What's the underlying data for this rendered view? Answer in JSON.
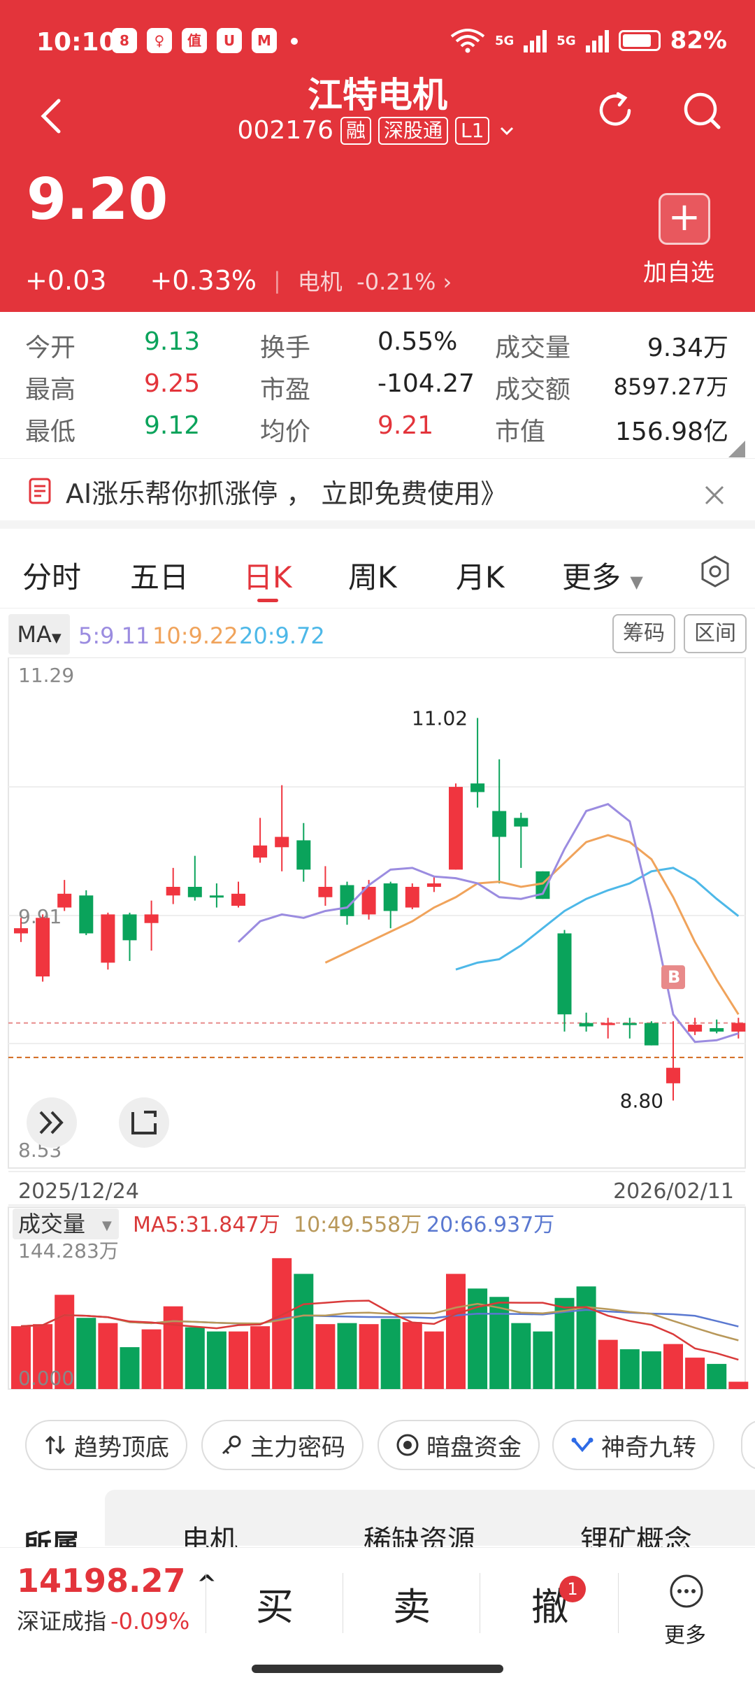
{
  "status": {
    "time": "10:10",
    "battery": "82%",
    "net1": "5G",
    "net2": "5G",
    "apps": [
      "8",
      "♀",
      "值",
      "U",
      "M"
    ]
  },
  "header": {
    "name": "江特电机",
    "code": "002176",
    "tags": [
      "融",
      "深股通",
      "L1"
    ],
    "price": "9.20",
    "change": "+0.03",
    "change_pct": "+0.33%",
    "sector_name": "电机",
    "sector_chg": "-0.21%",
    "add_label": "加自选",
    "add_icon": "+"
  },
  "quote": {
    "open_label": "今开",
    "open": "9.13",
    "high_label": "最高",
    "high": "9.25",
    "low_label": "最低",
    "low": "9.12",
    "turnover_label": "换手",
    "turnover": "0.55%",
    "pe_label": "市盈",
    "pe": "-104.27",
    "avg_label": "均价",
    "avg": "9.21",
    "vol_label": "成交量",
    "vol": "9.34万",
    "amt_label": "成交额",
    "amt": "8597.27万",
    "mcap_label": "市值",
    "mcap": "156.98亿"
  },
  "ai_banner": {
    "text": "AI涨乐帮你抓涨停 ， 立即免费使用》"
  },
  "tabs": [
    "分时",
    "五日",
    "日K",
    "周K",
    "月K",
    "更多"
  ],
  "ma_legend": {
    "btn": "MA",
    "ma5": "5:9.11",
    "ma10": "10:9.22",
    "ma20": "20:9.72",
    "btn_chip": "筹码",
    "btn_range": "区间"
  },
  "colors": {
    "up": "#F0353F",
    "down": "#0AA35B",
    "ma5": "#9B8CE0",
    "ma10": "#F0A35B",
    "ma20": "#4DB8E8",
    "vol_ma5": "#D93A3A",
    "vol_ma10": "#B8985A",
    "vol_ma20": "#5A78D0"
  },
  "chart_data": {
    "type": "candlestick",
    "y_top_label": "11.29",
    "y_mid_label": "9.91",
    "y_bottom_label": "8.53",
    "date_start": "2025/12/24",
    "date_end": "2026/02/11",
    "max_label": "11.02",
    "min_label": "8.80",
    "buy_marker": "B",
    "candles": [
      {
        "o": 9.77,
        "c": 9.8,
        "h": 9.86,
        "l": 9.72,
        "up": true
      },
      {
        "o": 9.52,
        "c": 9.86,
        "h": 9.88,
        "l": 9.49,
        "up": true
      },
      {
        "o": 9.92,
        "c": 10.0,
        "h": 10.08,
        "l": 9.9,
        "up": true
      },
      {
        "o": 9.99,
        "c": 9.77,
        "h": 10.02,
        "l": 9.76,
        "up": false
      },
      {
        "o": 9.6,
        "c": 9.88,
        "h": 9.89,
        "l": 9.56,
        "up": true
      },
      {
        "o": 9.88,
        "c": 9.73,
        "h": 9.89,
        "l": 9.61,
        "up": false
      },
      {
        "o": 9.83,
        "c": 9.88,
        "h": 9.96,
        "l": 9.67,
        "up": true
      },
      {
        "o": 9.99,
        "c": 10.04,
        "h": 10.15,
        "l": 9.94,
        "up": true
      },
      {
        "o": 10.04,
        "c": 9.98,
        "h": 10.22,
        "l": 9.96,
        "up": false
      },
      {
        "o": 9.99,
        "c": 9.99,
        "h": 10.06,
        "l": 9.92,
        "up": false
      },
      {
        "o": 9.93,
        "c": 10.0,
        "h": 10.07,
        "l": 9.92,
        "up": true
      },
      {
        "o": 10.21,
        "c": 10.28,
        "h": 10.44,
        "l": 10.18,
        "up": true
      },
      {
        "o": 10.27,
        "c": 10.33,
        "h": 10.63,
        "l": 10.13,
        "up": true
      },
      {
        "o": 10.31,
        "c": 10.14,
        "h": 10.41,
        "l": 10.07,
        "up": false
      },
      {
        "o": 9.98,
        "c": 10.04,
        "h": 10.16,
        "l": 9.93,
        "up": true
      },
      {
        "o": 10.05,
        "c": 9.87,
        "h": 10.07,
        "l": 9.82,
        "up": false
      },
      {
        "o": 9.88,
        "c": 10.04,
        "h": 10.08,
        "l": 9.85,
        "up": true
      },
      {
        "o": 10.06,
        "c": 9.9,
        "h": 10.07,
        "l": 9.8,
        "up": false
      },
      {
        "o": 9.92,
        "c": 10.04,
        "h": 10.06,
        "l": 9.91,
        "up": true
      },
      {
        "o": 10.04,
        "c": 10.06,
        "h": 10.1,
        "l": 10.01,
        "up": true
      },
      {
        "o": 10.14,
        "c": 10.62,
        "h": 10.64,
        "l": 10.14,
        "up": true
      },
      {
        "o": 10.59,
        "c": 10.64,
        "h": 11.02,
        "l": 10.5,
        "up": false
      },
      {
        "o": 10.48,
        "c": 10.33,
        "h": 10.78,
        "l": 10.06,
        "up": false
      },
      {
        "o": 10.39,
        "c": 10.44,
        "h": 10.47,
        "l": 10.15,
        "up": false
      },
      {
        "o": 10.13,
        "c": 9.97,
        "h": 10.13,
        "l": 9.97,
        "up": false
      },
      {
        "o": 9.77,
        "c": 9.3,
        "h": 9.79,
        "l": 9.2,
        "up": false
      },
      {
        "o": 9.25,
        "c": 9.23,
        "h": 9.31,
        "l": 9.2,
        "up": false
      },
      {
        "o": 9.25,
        "c": 9.25,
        "h": 9.28,
        "l": 9.16,
        "up": true
      },
      {
        "o": 9.25,
        "c": 9.25,
        "h": 9.28,
        "l": 9.16,
        "up": false
      },
      {
        "o": 9.25,
        "c": 9.12,
        "h": 9.26,
        "l": 9.12,
        "up": false
      },
      {
        "o": 8.9,
        "c": 8.99,
        "h": 9.26,
        "l": 8.8,
        "up": true
      },
      {
        "o": 9.2,
        "c": 9.24,
        "h": 9.28,
        "l": 9.18,
        "up": true
      },
      {
        "o": 9.22,
        "c": 9.2,
        "h": 9.27,
        "l": 9.19,
        "up": false
      },
      {
        "o": 9.2,
        "c": 9.25,
        "h": 9.28,
        "l": 9.16,
        "up": true
      }
    ],
    "ma5": [
      9.72,
      9.84,
      9.88,
      9.86,
      9.9,
      9.92,
      10.05,
      10.14,
      10.15,
      10.1,
      10.09,
      10.06,
      9.98,
      9.97,
      10.0,
      10.26,
      10.48,
      10.52,
      10.42,
      9.9,
      9.3,
      9.14,
      9.15,
      9.19
    ],
    "ma10": [
      9.6,
      9.66,
      9.72,
      9.78,
      9.84,
      9.92,
      9.98,
      10.06,
      10.07,
      10.04,
      10.06,
      10.18,
      10.3,
      10.34,
      10.3,
      10.2,
      9.98,
      9.72,
      9.5,
      9.3
    ],
    "ma20": [
      9.56,
      9.6,
      9.62,
      9.7,
      9.8,
      9.9,
      9.97,
      10.02,
      10.06,
      10.13,
      10.15,
      10.08,
      9.97,
      9.87
    ],
    "ma5_label": "MA5:31.847万",
    "ma10_label": "10:49.558万",
    "ma20_label": "20:66.937万",
    "vol_title": "成交量",
    "vol_max_label": "144.283万",
    "vol_min_label": "0.000",
    "volumes": [
      60,
      62,
      90,
      68,
      63,
      40,
      57,
      79,
      59,
      55,
      55,
      60,
      125,
      110,
      62,
      63,
      62,
      67,
      64,
      55,
      110,
      96,
      88,
      63,
      55,
      87,
      98,
      47,
      38,
      36,
      43,
      30,
      24,
      7
    ]
  },
  "indicators": [
    "趋势顶底",
    "主力密码",
    "暗盘资金",
    "神奇九转"
  ],
  "sectors": {
    "label": "所属",
    "items": [
      "电机",
      "稀缺资源",
      "锂矿概念"
    ]
  },
  "bottom": {
    "index_value": "14198.27",
    "index_arrow": "^",
    "index_name": "深证成指",
    "index_chg": "-0.09%",
    "buy": "买",
    "sell": "卖",
    "cancel": "撤",
    "badge": "1",
    "more": "更多"
  }
}
